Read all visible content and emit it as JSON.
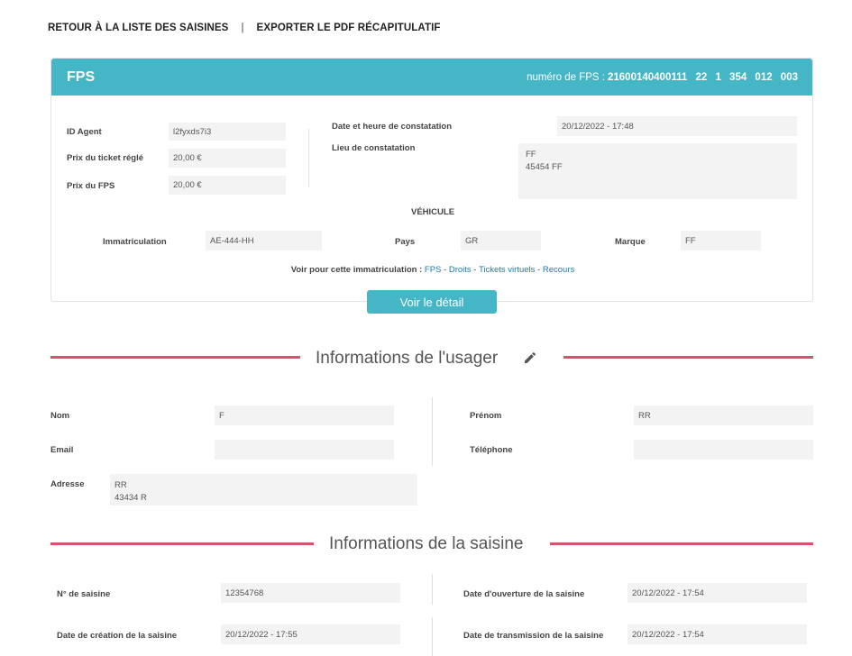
{
  "nav": {
    "back_label": "RETOUR À LA LISTE DES SAISINES",
    "separator": "|",
    "export_label": "EXPORTER LE PDF RÉCAPITULATIF"
  },
  "fps": {
    "title": "FPS",
    "number_label": "numéro de FPS :",
    "number_value": "21600140400111 22 1 354 012 003",
    "agent_label": "ID Agent",
    "agent_value": "l2fyxds7i3",
    "ticket_label": "Prix du ticket réglé",
    "ticket_value": "20,00 €",
    "price_label": "Prix du FPS",
    "price_value": "20,00 €",
    "date_label": "Date et heure de constatation",
    "date_value": "20/12/2022 - 17:48",
    "place_label": "Lieu de constatation",
    "place_value": "FF\n45454 FF",
    "vehicle_heading": "VÉHICULE",
    "plate_label": "Immatriculation",
    "plate_value": "AE-444-HH",
    "country_label": "Pays",
    "country_value": "GR",
    "brand_label": "Marque",
    "brand_value": "FF",
    "see_label": "Voir pour cette immatriculation :",
    "links": [
      "FPS",
      "Droits",
      "Tickets virtuels",
      "Recours"
    ],
    "link_sep": " - ",
    "detail_button": "Voir le détail"
  },
  "user": {
    "title": "Informations de l'usager",
    "edit_icon": "pencil-icon",
    "lastname_label": "Nom",
    "lastname_value": "F",
    "firstname_label": "Prénom",
    "firstname_value": "RR",
    "email_label": "Email",
    "email_value": "",
    "phone_label": "Téléphone",
    "phone_value": "",
    "address_label": "Adresse",
    "address_value": "RR\n43434 R"
  },
  "saisine": {
    "title": "Informations de la saisine",
    "number_label": "N° de saisine",
    "number_value": "12354768",
    "open_label": "Date d'ouverture de la saisine",
    "open_value": "20/12/2022 - 17:54",
    "created_label": "Date de création de la saisine",
    "created_value": "20/12/2022 - 17:55",
    "transmit_label": "Date de transmission de la saisine",
    "transmit_value": "20/12/2022 - 17:54"
  },
  "colors": {
    "accent": "#45b6c6",
    "divider": "#d9516a",
    "link": "#1a7ca7",
    "field_bg": "#f3f3f3"
  }
}
